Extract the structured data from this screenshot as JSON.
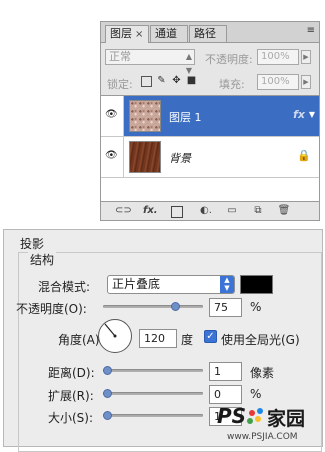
{
  "layers_panel": {
    "tabs": [
      "图层",
      "通道",
      "路径"
    ],
    "tab_close": "×",
    "panel_menu": "≡",
    "blend_mode": "正常",
    "opacity_label": "不透明度:",
    "opacity_value": "100%",
    "lock_label": "锁定:",
    "fill_label": "填充:",
    "fill_value": "100%",
    "layers": [
      {
        "name": "图层 1",
        "selected": true,
        "has_fx": true,
        "fx_label": "fx"
      },
      {
        "name": "背景",
        "selected": false,
        "locked": true
      }
    ]
  },
  "drop_shadow_dialog": {
    "title": "投影",
    "group_title": "结构",
    "blend_mode_label": "混合模式:",
    "blend_mode_value": "正片叠底",
    "shadow_color": "#000000",
    "opacity_label": "不透明度(O):",
    "opacity_value": "75",
    "opacity_unit": "%",
    "opacity_level": 0.75,
    "angle_label": "角度(A):",
    "angle_value": "120",
    "angle_unit": "度",
    "use_global_light_label": "使用全局光(G)",
    "use_global_light_checked": true,
    "distance_label": "距离(D):",
    "distance_value": "1",
    "distance_unit": "像素",
    "distance_level": 0.0,
    "spread_label": "扩展(R):",
    "spread_value": "0",
    "spread_unit": "%",
    "spread_level": 0.0,
    "size_label": "大小(S):",
    "size_value": "1",
    "size_level": 0.0
  },
  "watermark": {
    "brand": "PS",
    "brand_cn": "家园",
    "url": "www.PSJIA.COM"
  }
}
